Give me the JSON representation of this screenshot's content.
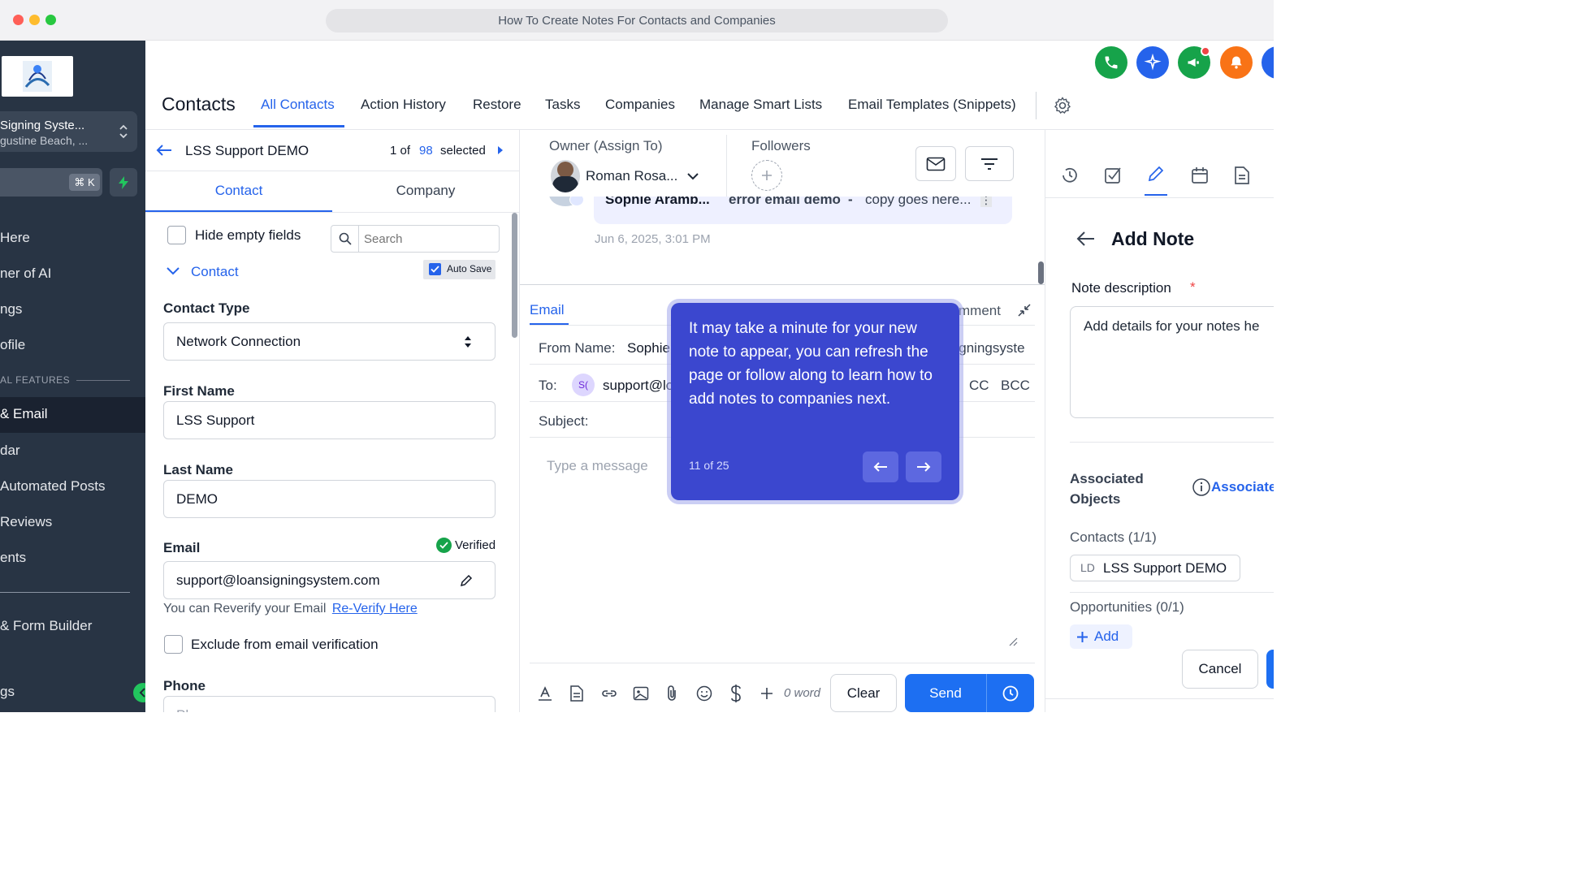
{
  "window": {
    "title": "How To Create Notes For Contacts and Companies"
  },
  "colors": {
    "accent": "#2563eb",
    "sidebar_bg": "#283444",
    "tooltip_bg": "#3b47cf",
    "verified": "#16a34a"
  },
  "sidebar": {
    "account_name": "Signing Syste...",
    "account_location": "gustine Beach, ...",
    "search_shortcut": "⌘ K",
    "items": [
      {
        "label": "Here"
      },
      {
        "label": "ner of AI"
      },
      {
        "label": "ngs"
      },
      {
        "label": "ofile"
      },
      {
        "label": "& Email"
      },
      {
        "label": "dar"
      },
      {
        "label": "Automated Posts"
      },
      {
        "label": "Reviews"
      },
      {
        "label": "ents"
      },
      {
        "label": "& Form Builder"
      },
      {
        "label": "gs"
      }
    ],
    "section_label": "AL FEATURES"
  },
  "header": {
    "page_title": "Contacts",
    "tabs": [
      {
        "label": "All Contacts"
      },
      {
        "label": "Action History"
      },
      {
        "label": "Restore"
      },
      {
        "label": "Tasks"
      },
      {
        "label": "Companies"
      },
      {
        "label": "Manage Smart Lists"
      },
      {
        "label": "Email Templates (Snippets)"
      }
    ],
    "icons": [
      "phone-icon",
      "sparkle-icon",
      "megaphone-icon",
      "bell-icon",
      "settings-icon"
    ]
  },
  "contact_panel": {
    "name": "LSS Support DEMO",
    "pager_prefix": "1 of",
    "pager_total": "98",
    "pager_suffix": "selected",
    "tabs": [
      {
        "label": "Contact"
      },
      {
        "label": "Company"
      }
    ],
    "hide_empty_label": "Hide empty fields",
    "search_placeholder": "Search",
    "section_title": "Contact",
    "auto_save_label": "Auto Save",
    "fields": {
      "contact_type": {
        "label": "Contact Type",
        "value": "Network Connection"
      },
      "first_name": {
        "label": "First Name",
        "value": "LSS Support"
      },
      "last_name": {
        "label": "Last Name",
        "value": "DEMO"
      },
      "email": {
        "label": "Email",
        "value": "support@loansigningsystem.com",
        "verified_label": "Verified"
      },
      "reverify_text": "You can Reverify your Email",
      "reverify_link": "Re-Verify Here",
      "exclude_label": "Exclude from email verification",
      "phone": {
        "label": "Phone",
        "placeholder": "Ph..."
      }
    }
  },
  "conversation": {
    "owner_label": "Owner (Assign To)",
    "owner_name": "Roman Rosa...",
    "followers_label": "Followers",
    "message_preview_sender": "Sophie Aramb...",
    "message_preview_subject": "error email demo",
    "message_preview_sep": "-",
    "message_preview_body": "copy goes here...",
    "message_time": "Jun 6, 2025, 3:01 PM",
    "composer": {
      "tab_email": "Email",
      "tab_comment": "mment",
      "from_label": "From Name:",
      "from_value": "Sophie",
      "from_domain": "signingsyste",
      "to_label": "To:",
      "to_avatar": "S(",
      "to_value": "support@lo",
      "cc": "CC",
      "bcc": "BCC",
      "subject_label": "Subject:",
      "message_placeholder": "Type a message",
      "word_count": "0 word",
      "clear_label": "Clear",
      "send_label": "Send"
    }
  },
  "tooltip": {
    "text": "It may take a minute for your new note to appear, you can refresh the page or follow along to learn how to add notes to companies next.",
    "progress": "11 of 25"
  },
  "note_panel": {
    "title": "Add Note",
    "description_label": "Note description",
    "required_mark": "*",
    "description_placeholder": "Add details for your notes he",
    "associated_label": "Associated Objects",
    "associate_link": "Associate",
    "contacts_label": "Contacts (1/1)",
    "contact_chip_initials": "LD",
    "contact_chip_name": "LSS Support DEMO",
    "opportunities_label": "Opportunities (0/1)",
    "add_label": "Add",
    "cancel_label": "Cancel"
  }
}
